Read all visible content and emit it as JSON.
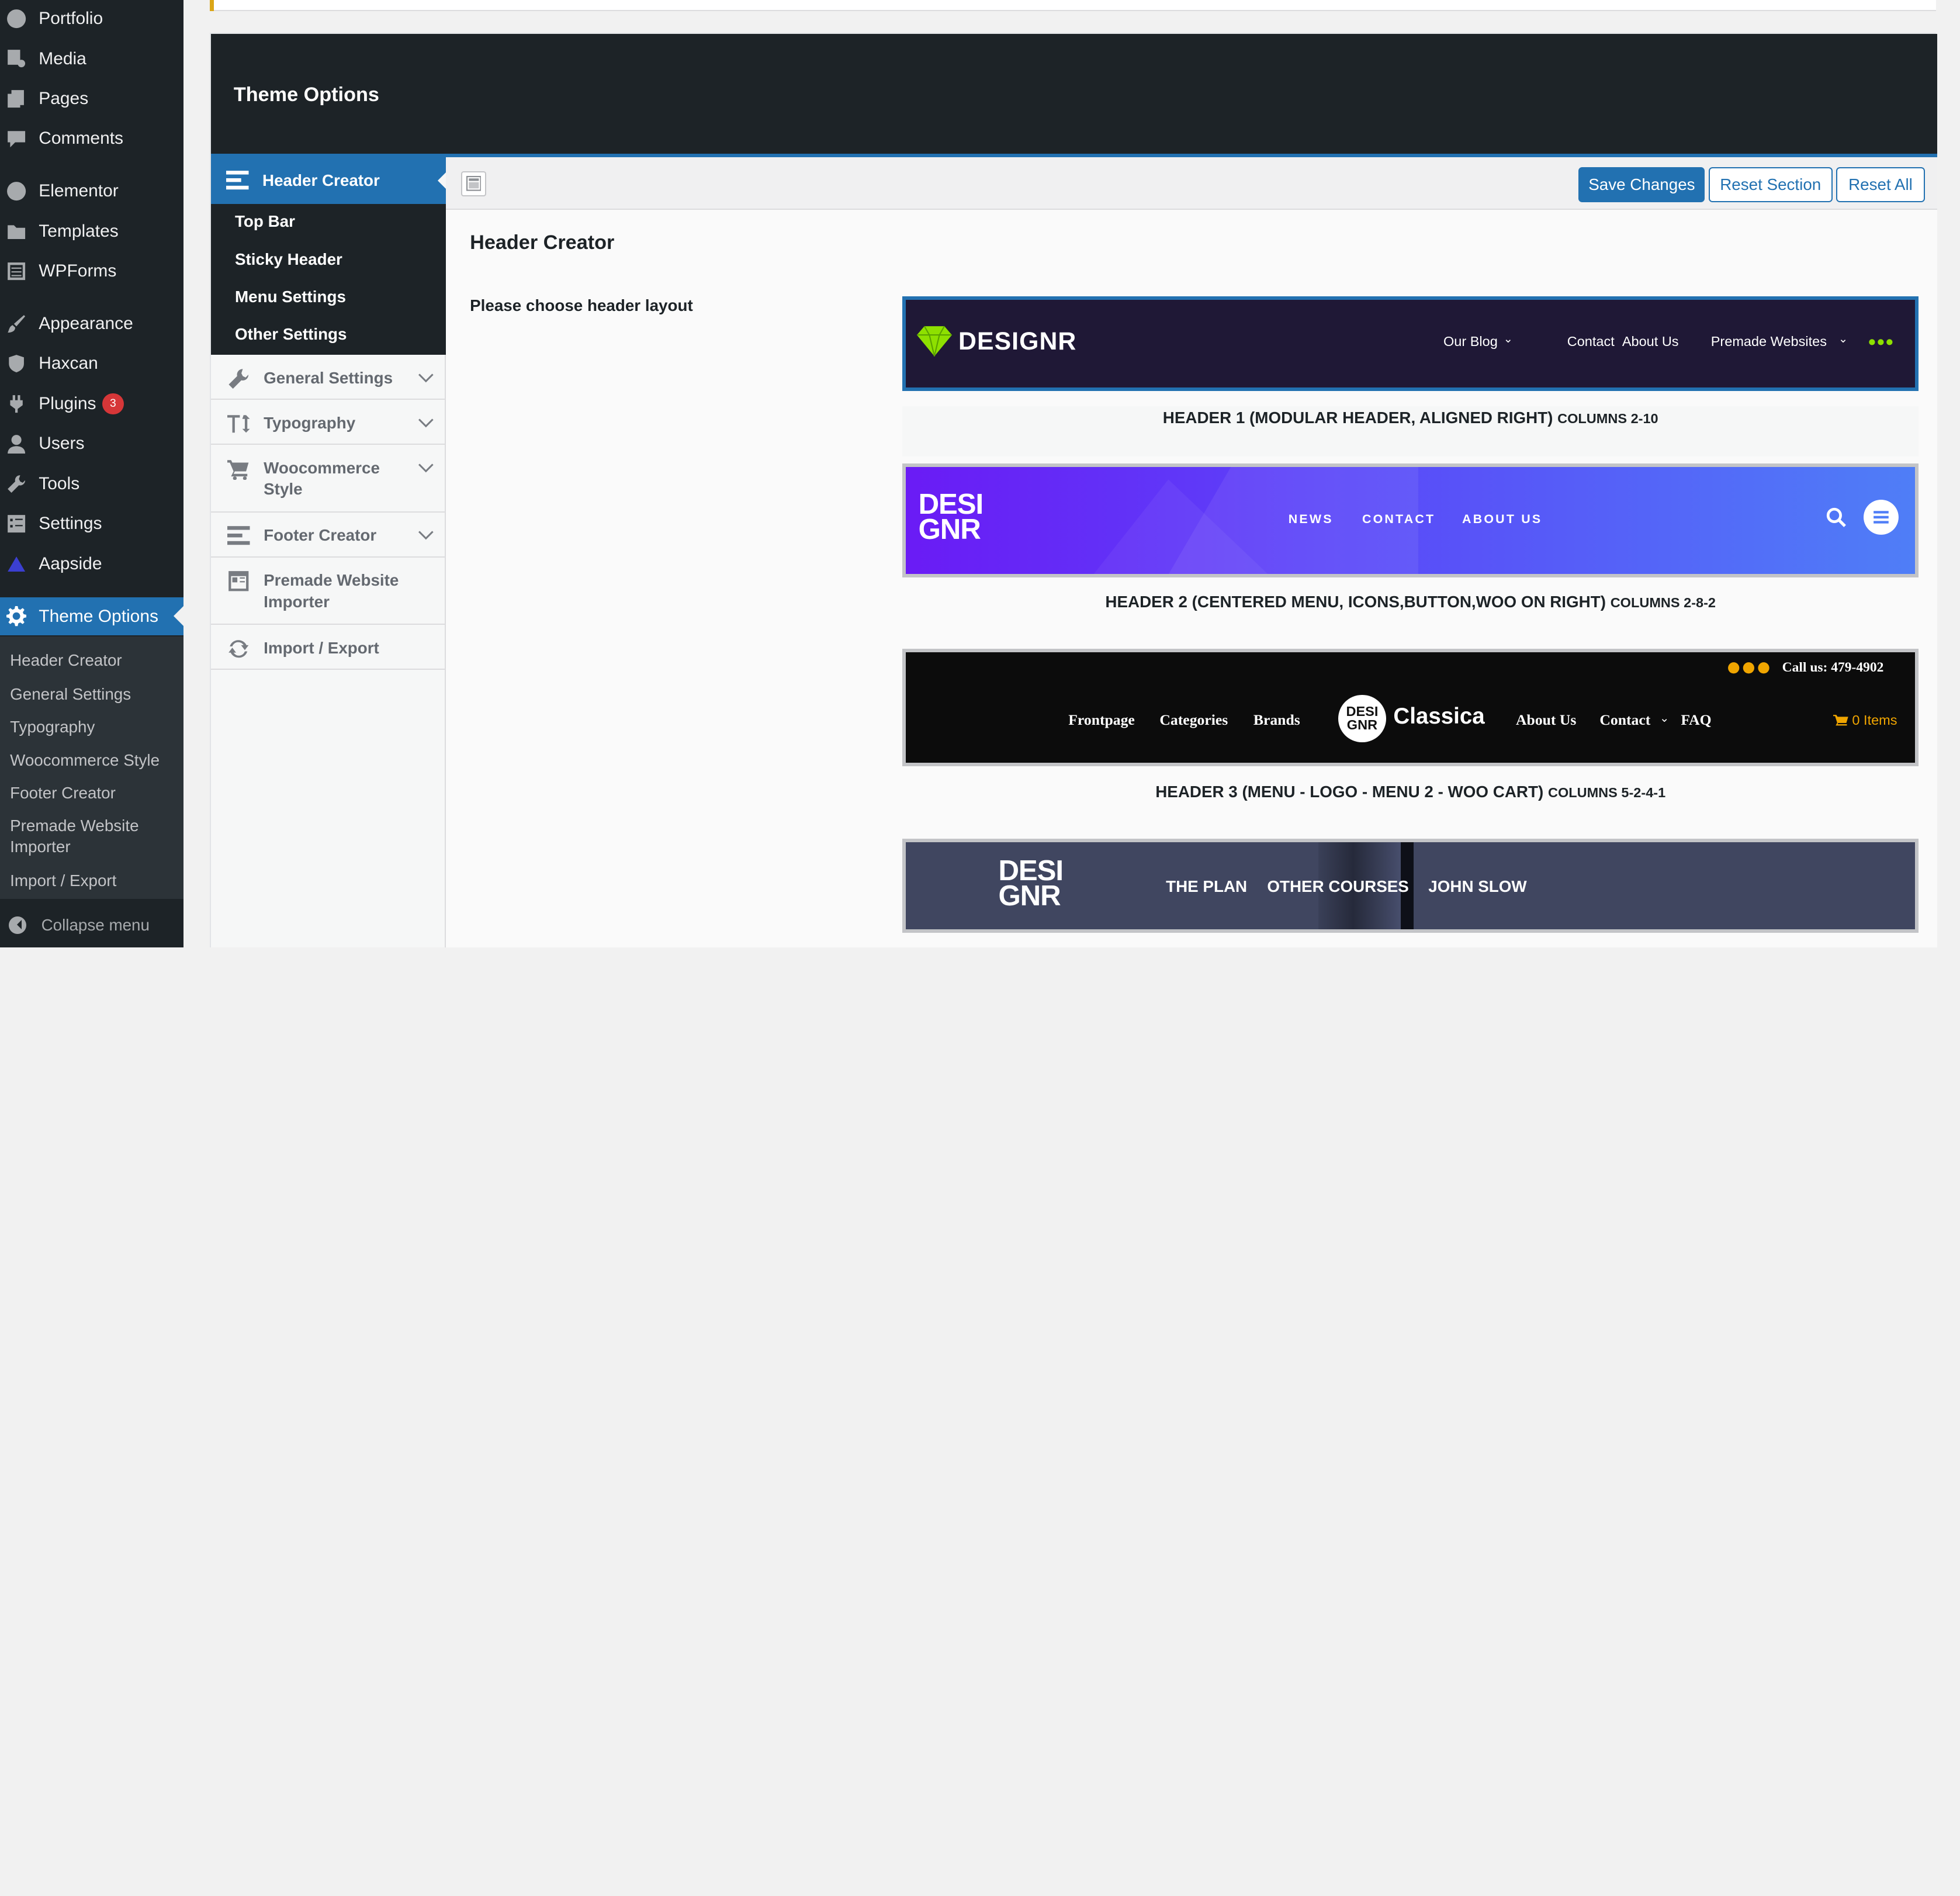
{
  "wp_menu": {
    "portfolio": "Portfolio",
    "media": "Media",
    "pages": "Pages",
    "comments": "Comments",
    "elementor": "Elementor",
    "templates": "Templates",
    "wpforms": "WPForms",
    "appearance": "Appearance",
    "haxcan": "Haxcan",
    "plugins": "Plugins",
    "plugins_badge": "3",
    "users": "Users",
    "tools": "Tools",
    "settings": "Settings",
    "aapside": "Aapside",
    "theme_options": "Theme Options",
    "collapse": "Collapse menu"
  },
  "wp_submenu": {
    "header_creator": "Header Creator",
    "general_settings": "General Settings",
    "typography": "Typography",
    "woocommerce_style": "Woocommerce Style",
    "footer_creator": "Footer Creator",
    "premade_importer": "Premade Website Importer",
    "import_export": "Import / Export"
  },
  "panel": {
    "title": "Theme Options"
  },
  "sections": {
    "header_creator": "Header Creator",
    "sub": {
      "top_bar": "Top Bar",
      "sticky_header": "Sticky Header",
      "menu_settings": "Menu Settings",
      "other_settings": "Other Settings"
    },
    "general_settings": "General Settings",
    "typography": "Typography",
    "woocommerce_style": "Woocommerce Style",
    "footer_creator": "Footer Creator",
    "premade_importer": "Premade Website Importer",
    "import_export": "Import / Export"
  },
  "toolbar": {
    "save": "Save Changes",
    "reset_section": "Reset Section",
    "reset_all": "Reset All"
  },
  "main": {
    "section_title": "Header Creator",
    "field_label": "Please choose header layout"
  },
  "layouts": [
    {
      "caption": "HEADER 1 (MODULAR HEADER, ALIGNED RIGHT)",
      "columns": "COLUMNS 2-10",
      "logo": "DESIGNR",
      "menu": [
        "Our Blog",
        "Contact",
        "About Us",
        "Premade Websites"
      ]
    },
    {
      "caption": "HEADER 2 (CENTERED MENU, ICONS,BUTTON,WOO ON RIGHT)",
      "columns": "COLUMNS 2-8-2",
      "logo_line1": "DESI",
      "logo_line2": "GNR",
      "menu": [
        "NEWS",
        "CONTACT",
        "ABOUT US"
      ]
    },
    {
      "caption": "HEADER 3 (MENU - LOGO - MENU 2 - WOO CART)",
      "columns": "COLUMNS 5-2-4-1",
      "call": "Call us: 479-4902",
      "menu_left": [
        "Frontpage",
        "Categories",
        "Brands"
      ],
      "logo_badge_line1": "DESI",
      "logo_badge_line2": "GNR",
      "logo_text": "Classica",
      "menu_right": [
        "About Us",
        "Contact",
        "FAQ"
      ],
      "cart": "0 Items"
    },
    {
      "logo_line1": "DESI",
      "logo_line2": "GNR",
      "menu": [
        "THE PLAN",
        "OTHER COURSES",
        "JOHN SLOW"
      ]
    }
  ],
  "colors": {
    "admin_bar": "#1d2327",
    "accent": "#2271b1",
    "header1_bg": "#1f1836",
    "designr_green": "#8ee000"
  }
}
